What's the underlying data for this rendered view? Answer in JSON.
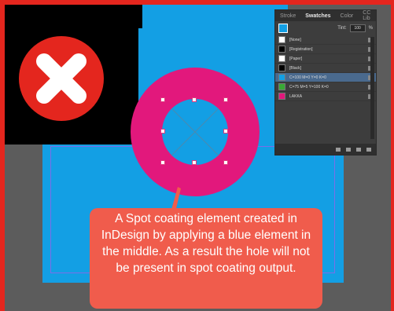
{
  "colors": {
    "frame": "#e4261e",
    "canvas": "#5c5c5c",
    "artboard": "#139fe4",
    "ring": "#e2187c",
    "callout": "#f05c4c",
    "badge": "#e4261e"
  },
  "icons": {
    "badge": "x-mark-icon"
  },
  "swatches_panel": {
    "tabs": [
      "Stroke",
      "Swatches",
      "Color",
      "CC Lib"
    ],
    "tint_label": "Tint:",
    "tint_value": "100",
    "tint_unit": "%",
    "swatches": [
      {
        "name": "[None]",
        "color": "#ffffff"
      },
      {
        "name": "[Registration]",
        "color": "#000000"
      },
      {
        "name": "[Paper]",
        "color": "#ffffff"
      },
      {
        "name": "[Black]",
        "color": "#000000"
      },
      {
        "name": "C=100 M=0 Y=0 K=0",
        "color": "#139fe4",
        "selected": true
      },
      {
        "name": "C=75 M=5 Y=100 K=0",
        "color": "#39a935"
      },
      {
        "name": "LAKKA",
        "color": "#e2187c"
      }
    ]
  },
  "callout": {
    "text": "A Spot coating element created in InDesign by applying a blue element in the middle. As a result the hole will not be present in spot coating output."
  }
}
